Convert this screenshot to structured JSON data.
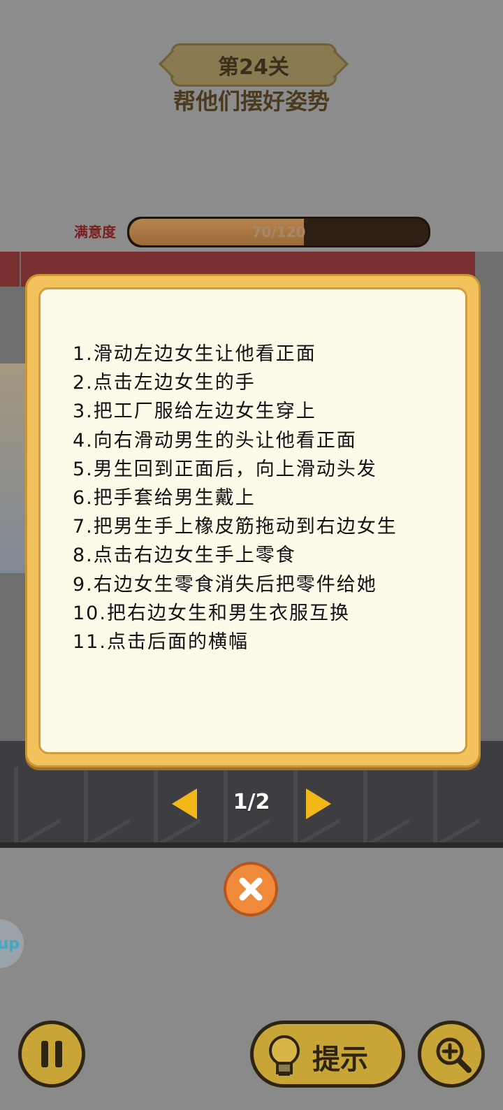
{
  "level": {
    "title": "第24关",
    "subtitle": "帮他们摆好姿势"
  },
  "satisfaction": {
    "label": "满意度",
    "current": 70,
    "max": 120,
    "text": "70/120"
  },
  "hint_dialog": {
    "steps": [
      "1.滑动左边女生让他看正面",
      "2.点击左边女生的手",
      "3.把工厂服给左边女生穿上",
      "4.向右滑动男生的头让他看正面",
      "5.男生回到正面后，向上滑动头发",
      "6.把手套给男生戴上",
      "7.把男生手上橡皮筋拖动到右边女生",
      "8.点击右边女生手上零食",
      "9.右边女生零食消失后把零件给她",
      "10.把右边女生和男生衣服互换",
      "11.点击后面的横幅"
    ],
    "page": "1/2"
  },
  "side_chip": {
    "label": "up"
  },
  "bottom_bar": {
    "hint_label": "提示"
  },
  "icons": {
    "prev": "chevron-left-icon",
    "next": "chevron-right-icon",
    "close": "close-icon",
    "pause": "pause-icon",
    "hint": "lightbulb-icon",
    "zoom": "zoom-in-icon"
  },
  "colors": {
    "dialog_border": "#f3c25c",
    "dialog_bg": "#fdfaea",
    "accent_yellow": "#f3b818",
    "close_orange": "#f08a3a",
    "button_gold": "#c9a437"
  }
}
